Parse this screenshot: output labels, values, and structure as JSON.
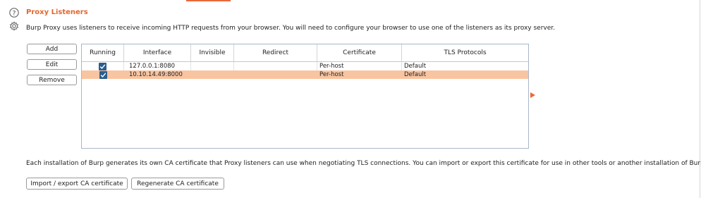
{
  "section": {
    "title": "Proxy Listeners",
    "description": "Burp Proxy uses listeners to receive incoming HTTP requests from your browser. You will need to configure your browser to use one of the listeners as its proxy server."
  },
  "buttons": {
    "add": "Add",
    "edit": "Edit",
    "remove": "Remove",
    "import_export": "Import / export CA certificate",
    "regenerate": "Regenerate CA certificate"
  },
  "table": {
    "columns": [
      "Running",
      "Interface",
      "Invisible",
      "Redirect",
      "Certificate",
      "TLS Protocols"
    ],
    "rows": [
      {
        "running": true,
        "interface": "127.0.0.1:8080",
        "invisible": "",
        "redirect": "",
        "certificate": "Per-host",
        "tls_protocols": "Default",
        "selected": false
      },
      {
        "running": true,
        "interface": "10.10.14.49:8000",
        "invisible": "",
        "redirect": "",
        "certificate": "Per-host",
        "tls_protocols": "Default",
        "selected": true
      }
    ]
  },
  "ca_note": "Each installation of Burp generates its own CA certificate that Proxy listeners can use when negotiating TLS connections. You can import or export this certificate for use in other tools or another installation of Burp.",
  "icons": {
    "help": "help-icon",
    "settings": "settings-icon",
    "checkbox": "checkmark-icon",
    "arrow": "triangle-right-icon"
  },
  "colors": {
    "accent": "#e3672f",
    "selected_row": "#f9c4a0",
    "checkbox": "#2a5d8f"
  }
}
